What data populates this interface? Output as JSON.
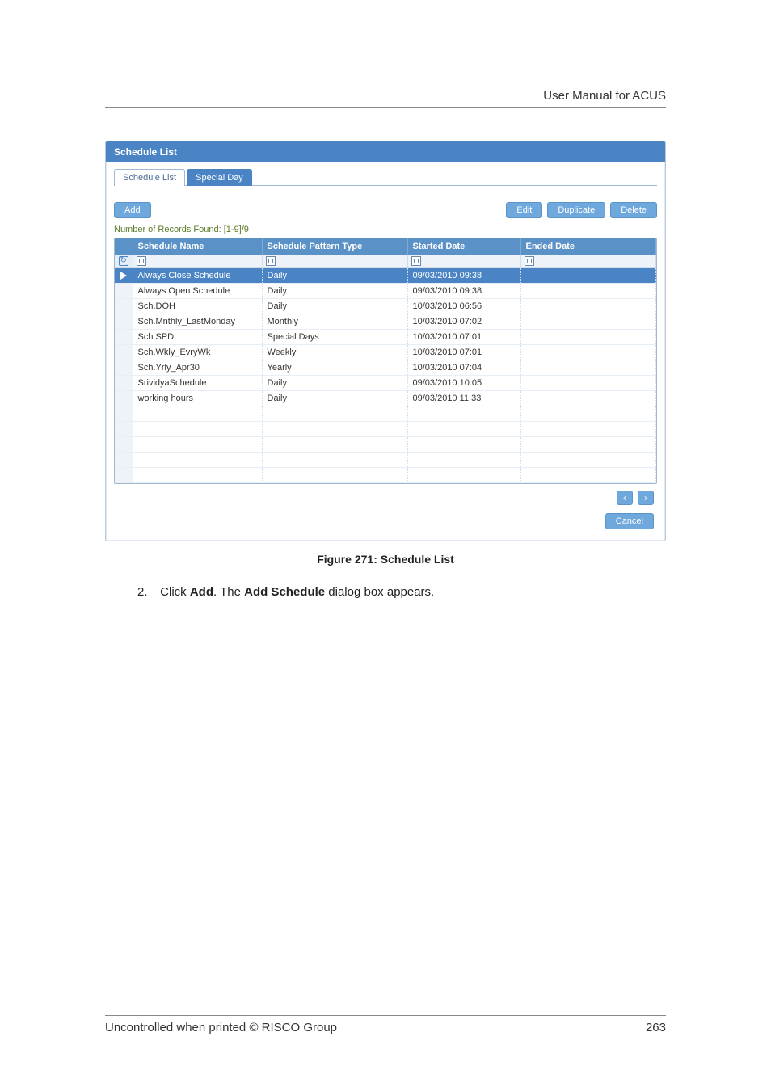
{
  "header": {
    "title": "User Manual for ACUS"
  },
  "app": {
    "title": "Schedule List",
    "tabs": [
      {
        "label": "Schedule List",
        "active": false
      },
      {
        "label": "Special Day",
        "active": true
      }
    ],
    "buttons": {
      "add": "Add",
      "edit": "Edit",
      "duplicate": "Duplicate",
      "delete": "Delete",
      "cancel": "Cancel"
    },
    "records_found": "Number of Records Found: [1-9]/9",
    "columns": [
      {
        "label": ""
      },
      {
        "label": "Schedule Name"
      },
      {
        "label": "Schedule Pattern Type"
      },
      {
        "label": "Started Date"
      },
      {
        "label": "Ended Date"
      }
    ],
    "rows": [
      {
        "name": "Always Close Schedule",
        "type": "Daily",
        "started": "09/03/2010 09:38",
        "ended": "",
        "selected": true
      },
      {
        "name": "Always Open Schedule",
        "type": "Daily",
        "started": "09/03/2010 09:38",
        "ended": ""
      },
      {
        "name": "Sch.DOH",
        "type": "Daily",
        "started": "10/03/2010 06:56",
        "ended": ""
      },
      {
        "name": "Sch.Mnthly_LastMonday",
        "type": "Monthly",
        "started": "10/03/2010 07:02",
        "ended": ""
      },
      {
        "name": "Sch.SPD",
        "type": "Special Days",
        "started": "10/03/2010 07:01",
        "ended": ""
      },
      {
        "name": "Sch.Wkly_EvryWk",
        "type": "Weekly",
        "started": "10/03/2010 07:01",
        "ended": ""
      },
      {
        "name": "Sch.Yrly_Apr30",
        "type": "Yearly",
        "started": "10/03/2010 07:04",
        "ended": ""
      },
      {
        "name": "SrividyaSchedule",
        "type": "Daily",
        "started": "09/03/2010 10:05",
        "ended": ""
      },
      {
        "name": "working hours",
        "type": "Daily",
        "started": "09/03/2010 11:33",
        "ended": ""
      }
    ],
    "empty_rows": 5
  },
  "figure_caption": "Figure 271: Schedule List",
  "instruction": {
    "number": "2.",
    "prefix": "Click ",
    "bold1": "Add",
    "mid": ". The ",
    "bold2": "Add Schedule",
    "suffix": " dialog box appears."
  },
  "footer": {
    "left": "Uncontrolled when printed © RISCO Group",
    "page": "263"
  }
}
